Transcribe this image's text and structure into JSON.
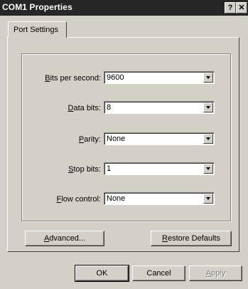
{
  "window": {
    "title": "COM1 Properties",
    "help_button": "?",
    "close_button": "✕"
  },
  "tabs": [
    {
      "label": "Port Settings",
      "selected": true
    }
  ],
  "fields": {
    "bits_per_second": {
      "mnemonic": "B",
      "label_rest": "its per second:",
      "value": "9600"
    },
    "data_bits": {
      "mnemonic": "D",
      "label_rest": "ata bits:",
      "value": "8"
    },
    "parity": {
      "mnemonic": "P",
      "label_rest": "arity:",
      "value": "None"
    },
    "stop_bits": {
      "mnemonic": "S",
      "label_rest": "top bits:",
      "value": "1"
    },
    "flow_control": {
      "mnemonic": "F",
      "label_rest": "low control:",
      "value": "None"
    }
  },
  "buttons": {
    "advanced": {
      "mnemonic": "A",
      "label_rest": "dvanced..."
    },
    "restore": {
      "mnemonic": "R",
      "label_rest": "estore Defaults"
    },
    "ok": "OK",
    "cancel": "Cancel",
    "apply": {
      "mnemonic": "A",
      "label_rest": "pply"
    }
  }
}
